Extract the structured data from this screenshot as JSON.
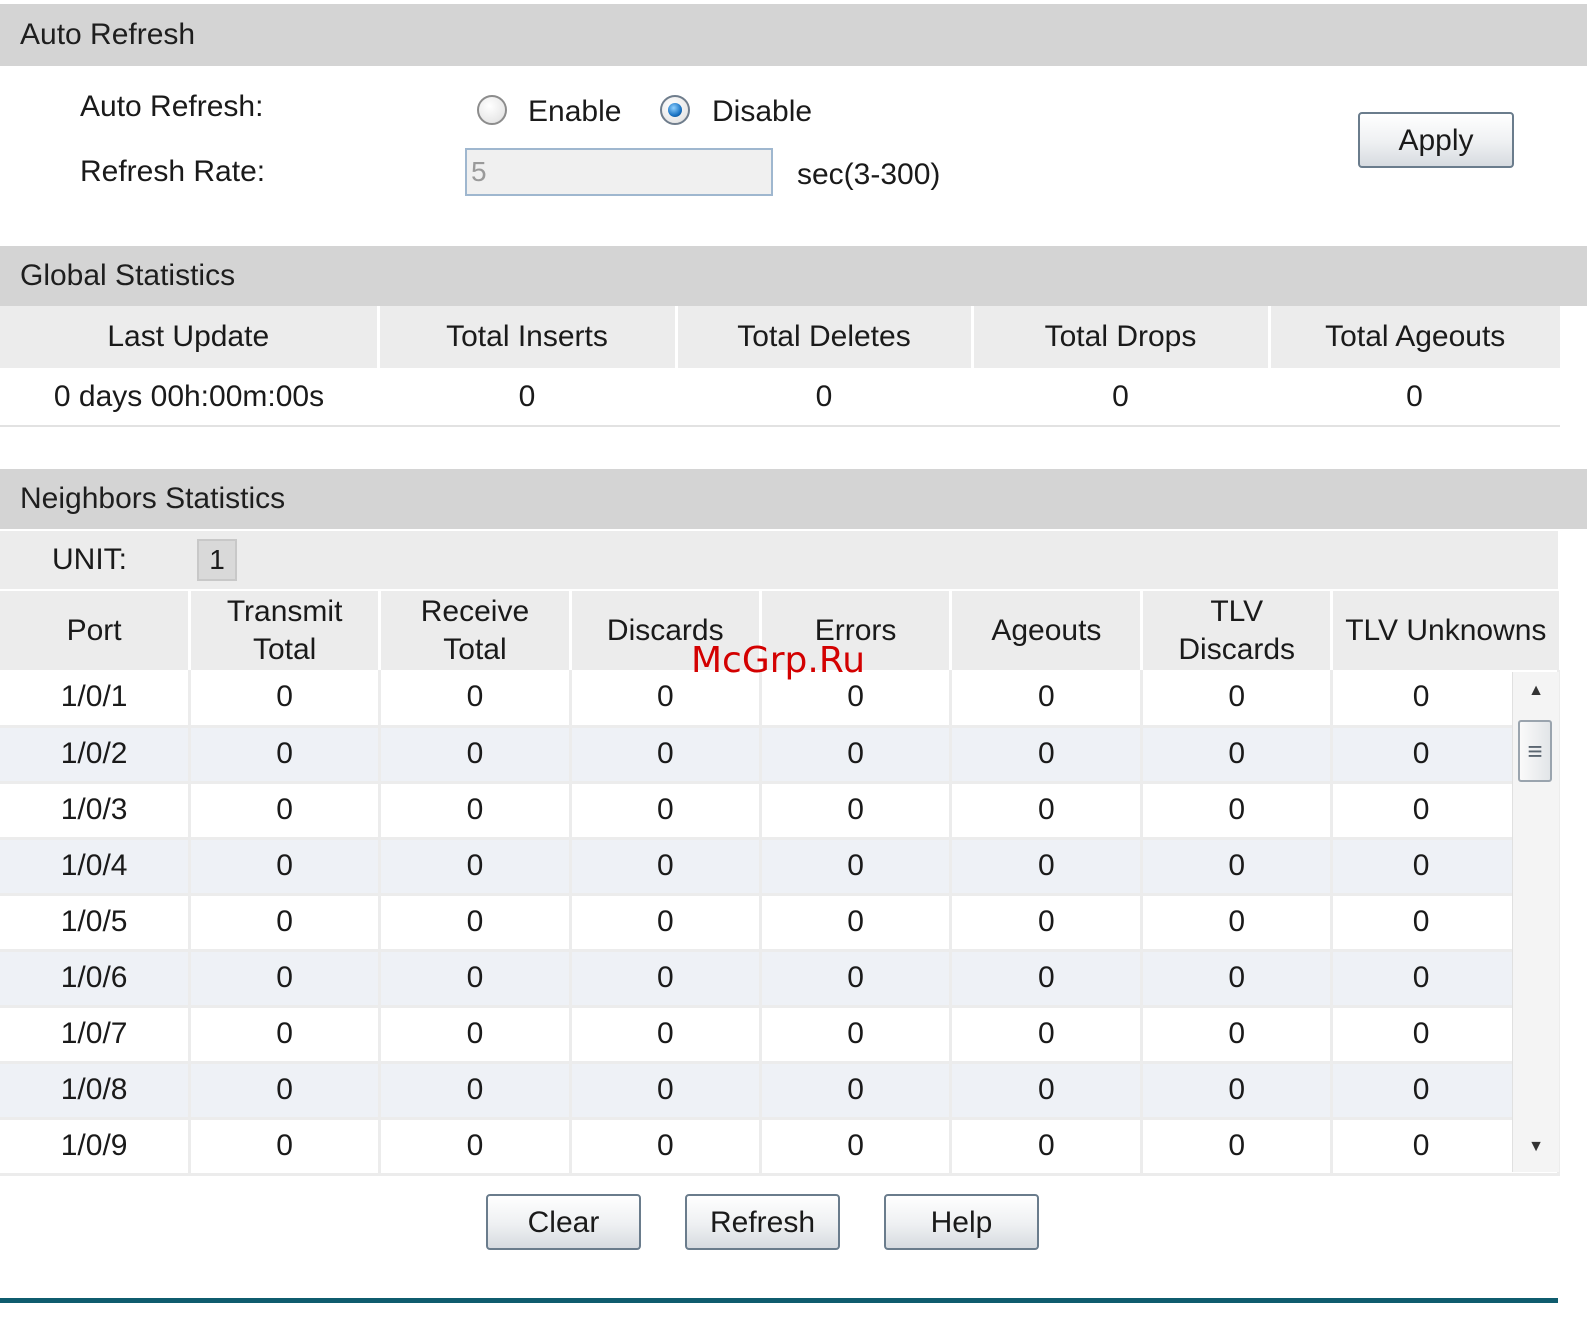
{
  "auto_refresh": {
    "section_title": "Auto Refresh",
    "auto_refresh_label": "Auto Refresh:",
    "enable_label": "Enable",
    "disable_label": "Disable",
    "selected": "Disable",
    "refresh_rate_label": "Refresh Rate:",
    "refresh_rate_value": "5",
    "refresh_rate_unit": "sec(3-300)",
    "apply_label": "Apply"
  },
  "global_statistics": {
    "section_title": "Global Statistics",
    "columns": [
      "Last Update",
      "Total Inserts",
      "Total Deletes",
      "Total Drops",
      "Total Ageouts"
    ],
    "values": [
      "0 days 00h:00m:00s",
      "0",
      "0",
      "0",
      "0"
    ]
  },
  "neighbors_statistics": {
    "section_title": "Neighbors Statistics",
    "unit_label": "UNIT:",
    "unit_value": "1",
    "columns": [
      [
        "Port"
      ],
      [
        "Transmit",
        "Total"
      ],
      [
        "Receive",
        "Total"
      ],
      [
        "Discards"
      ],
      [
        "Errors"
      ],
      [
        "Ageouts"
      ],
      [
        "TLV",
        "Discards"
      ],
      [
        "TLV Unknowns"
      ]
    ],
    "rows": [
      [
        "1/0/1",
        "0",
        "0",
        "0",
        "0",
        "0",
        "0",
        "0"
      ],
      [
        "1/0/2",
        "0",
        "0",
        "0",
        "0",
        "0",
        "0",
        "0"
      ],
      [
        "1/0/3",
        "0",
        "0",
        "0",
        "0",
        "0",
        "0",
        "0"
      ],
      [
        "1/0/4",
        "0",
        "0",
        "0",
        "0",
        "0",
        "0",
        "0"
      ],
      [
        "1/0/5",
        "0",
        "0",
        "0",
        "0",
        "0",
        "0",
        "0"
      ],
      [
        "1/0/6",
        "0",
        "0",
        "0",
        "0",
        "0",
        "0",
        "0"
      ],
      [
        "1/0/7",
        "0",
        "0",
        "0",
        "0",
        "0",
        "0",
        "0"
      ],
      [
        "1/0/8",
        "0",
        "0",
        "0",
        "0",
        "0",
        "0",
        "0"
      ],
      [
        "1/0/9",
        "0",
        "0",
        "0",
        "0",
        "0",
        "0",
        "0"
      ]
    ]
  },
  "buttons": {
    "clear": "Clear",
    "refresh": "Refresh",
    "help": "Help"
  },
  "watermark": "McGrp.Ru",
  "colors": {
    "section_header_bg": "#d4d4d4",
    "column_header_bg": "#ececec",
    "alt_row_bg": "#eef1f6",
    "footer_line": "#0f5c6e",
    "watermark": "#d30000"
  },
  "icons": {
    "scroll_up": "triangle-up-icon",
    "scroll_down": "triangle-down-icon",
    "scroll_grip": "grip-lines-icon"
  }
}
